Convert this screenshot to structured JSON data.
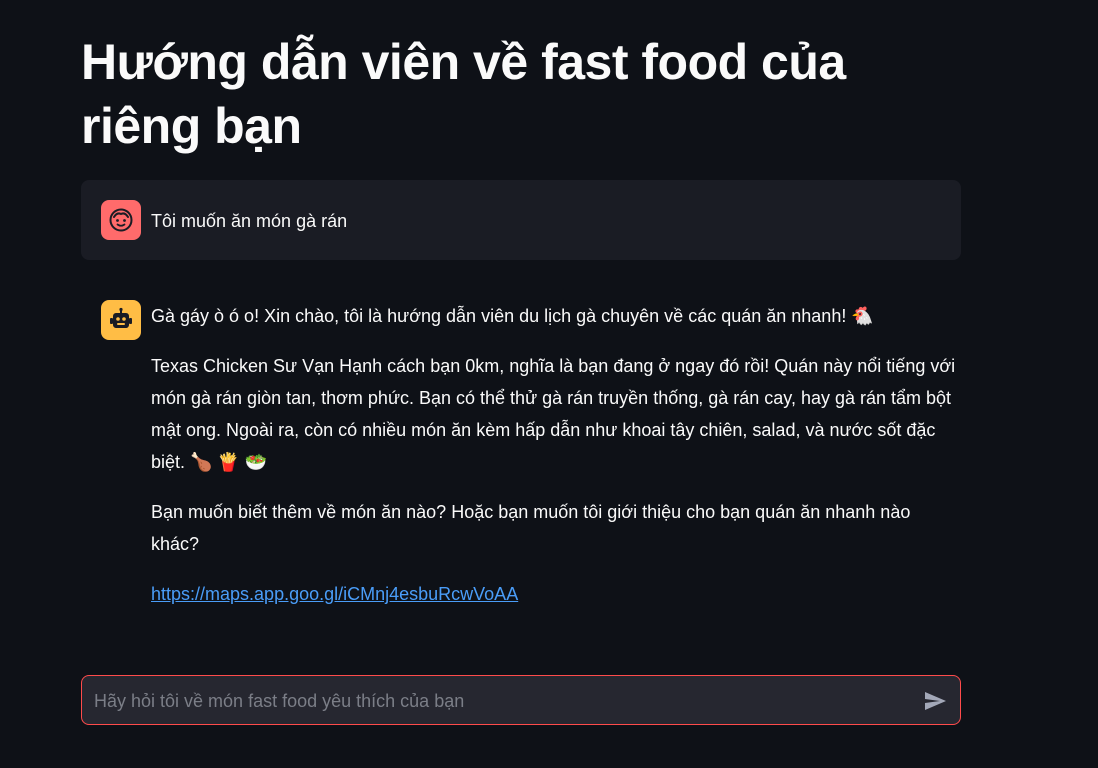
{
  "header": {
    "title": "Hướng dẫn viên về fast food của riêng bạn"
  },
  "chat": {
    "user_message": {
      "avatar_icon": "user-face-icon",
      "text": "Tôi muốn ăn món gà rán"
    },
    "assistant_message": {
      "avatar_icon": "bot-icon",
      "paragraphs": [
        "Gà gáy ò ó o! Xin chào, tôi là hướng dẫn viên du lịch gà chuyên về các quán ăn nhanh! 🐔",
        "Texas Chicken Sư Vạn Hạnh cách bạn 0km, nghĩa là bạn đang ở ngay đó rồi! Quán này nổi tiếng với món gà rán giòn tan, thơm phức. Bạn có thể thử gà rán truyền thống, gà rán cay, hay gà rán tẩm bột mật ong. Ngoài ra, còn có nhiều món ăn kèm hấp dẫn như khoai tây chiên, salad, và nước sốt đặc biệt. 🍗 🍟 🥗",
        "Bạn muốn biết thêm về món ăn nào? Hoặc bạn muốn tôi giới thiệu cho bạn quán ăn nhanh nào khác?"
      ],
      "link_text": "https://maps.app.goo.gl/iCMnj4esbuRcwVoAA"
    }
  },
  "chat_input": {
    "placeholder": "Hãy hỏi tôi về món fast food yêu thích của bạn",
    "value": "",
    "send_icon": "send-icon"
  },
  "colors": {
    "background": "#0e1117",
    "user_bubble": "#1a1c24",
    "user_avatar": "#ff6b6b",
    "bot_avatar": "#ffbd45",
    "link": "#4a9df8",
    "input_border": "#ff4b4b"
  }
}
